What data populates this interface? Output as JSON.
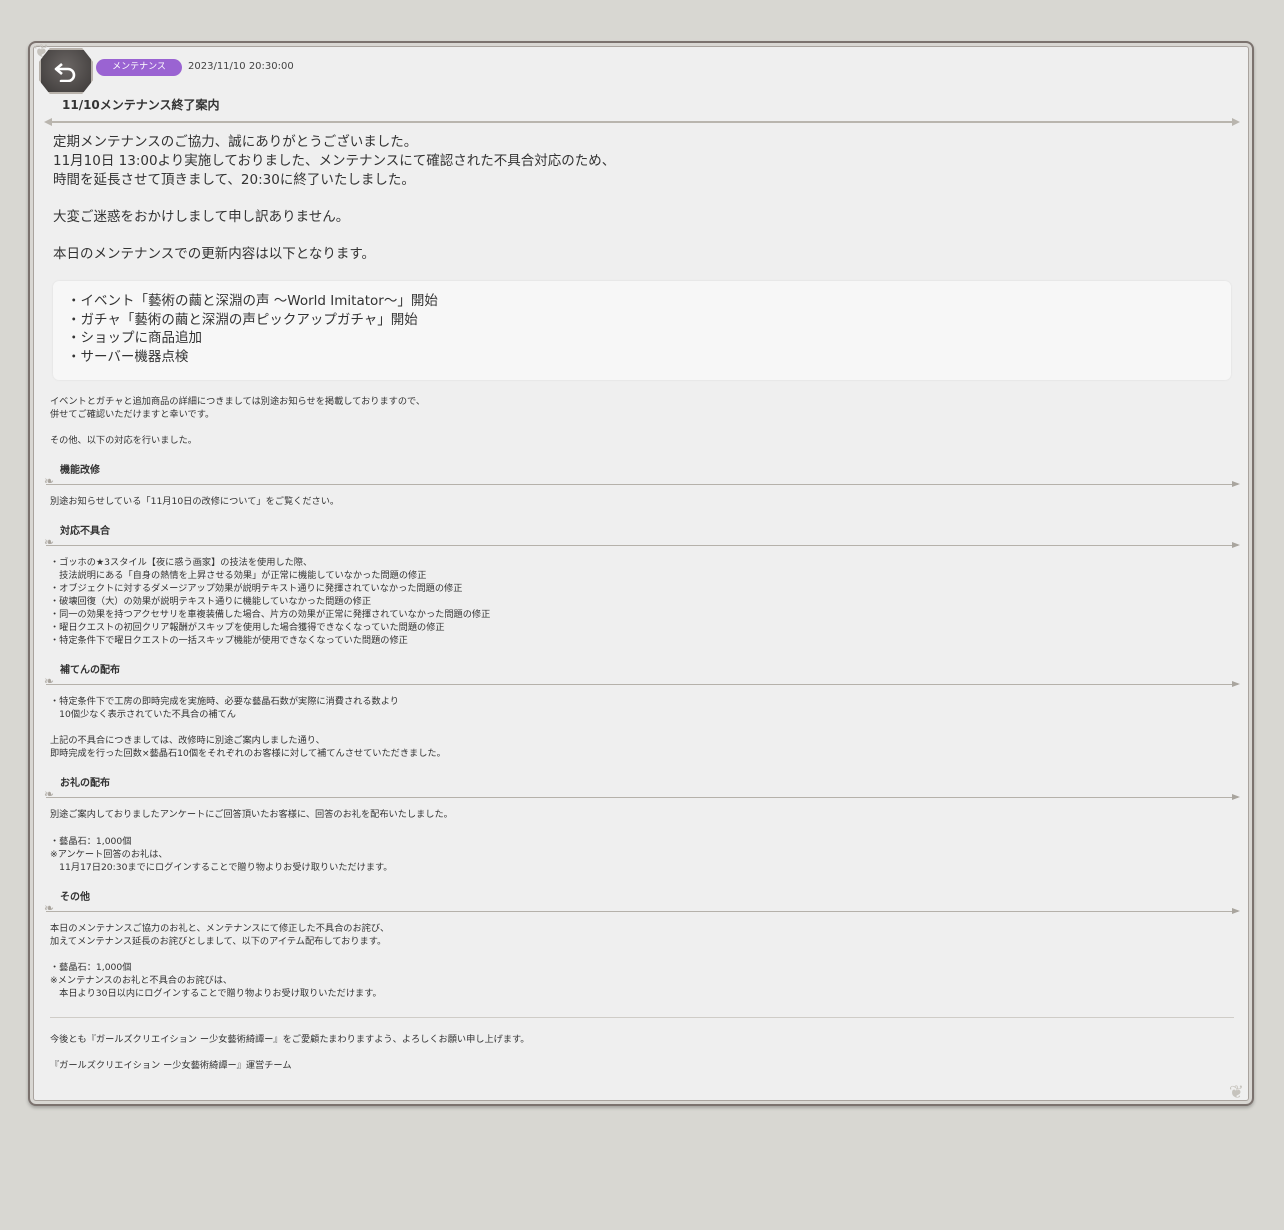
{
  "header": {
    "tag": "メンテナンス",
    "date": "2023/11/10 20:30:00",
    "title": "11/10メンテナンス終了案内",
    "back_icon": "back-arrow-icon"
  },
  "intro": [
    "定期メンテナンスのご協力、誠にありがとうございました。",
    "11月10日 13:00より実施しておりました、メンテナンスにて確認された不具合対応のため、",
    "時間を延長させて頂きまして、20:30に終了いたしました。",
    "大変ご迷惑をおかけしまして申し訳ありません。",
    "本日のメンテナンスでの更新内容は以下となります。"
  ],
  "updates": [
    "・イベント「藝術の繭と深淵の声 〜World Imitator〜」開始",
    "・ガチャ「藝術の繭と深淵の声ピックアップガチャ」開始",
    "・ショップに商品追加",
    "・サーバー機器点検"
  ],
  "notes": [
    "イベントとガチャと追加商品の詳細につきましては別途お知らせを掲載しておりますので、",
    "併せてご確認いただけますと幸いです。",
    "その他、以下の対応を行いました。"
  ],
  "sections": {
    "improve": {
      "title": "機能改修",
      "lines": [
        "別途お知らせしている「11月10日の改修について」をご覧ください。"
      ]
    },
    "bugs": {
      "title": "対応不具合",
      "lines": [
        "・ゴッホの★3スタイル【夜に惑う画家】の技法を使用した際、",
        "　技法説明にある「自身の熱情を上昇させる効果」が正常に機能していなかった問題の修正",
        "・オブジェクトに対するダメージアップ効果が説明テキスト通りに発揮されていなかった問題の修正",
        "・破壊回復（大）の効果が説明テキスト通りに機能していなかった問題の修正",
        "・同一の効果を持つアクセサリを車複装備した場合、片方の効果が正常に発揮されていなかった問題の修正",
        "・曜日クエストの初回クリア報酬がスキップを使用した場合獲得できなくなっていた問題の修正",
        "・特定条件下で曜日クエストの一括スキップ機能が使用できなくなっていた問題の修正"
      ]
    },
    "compensation": {
      "title": "補てんの配布",
      "lines": [
        "・特定条件下で工房の即時完成を実施時、必要な藝晶石数が実際に消費される数より",
        "　10個少なく表示されていた不具合の補てん",
        "上記の不具合につきましては、改修時に別途ご案内しました通り、",
        "即時完成を行った回数×藝晶石10個をそれぞれのお客様に対して補てんさせていただきました。"
      ]
    },
    "thanks": {
      "title": "お礼の配布",
      "lines": [
        "別途ご案内しておりましたアンケートにご回答頂いたお客様に、回答のお礼を配布いたしました。",
        "・藝晶石：1,000個",
        "※アンケート回答のお礼は、",
        "　11月17日20:30までにログインすることで贈り物よりお受け取りいただけます。"
      ]
    },
    "other": {
      "title": "その他",
      "lines": [
        "本日のメンテナンスご協力のお礼と、メンテナンスにて修正した不具合のお詫び、",
        "加えてメンテナンス延長のお詫びとしまして、以下のアイテム配布しております。",
        "・藝晶石：1,000個",
        "※メンテナンスのお礼と不具合のお詫びは、",
        "　本日より30日以内にログインすることで贈り物よりお受け取りいただけます。"
      ]
    }
  },
  "footer": [
    "今後とも『ガールズクリエイション ー少女藝術綺譚ー』をご愛顧たまわりますよう、よろしくお願い申し上げます。",
    "『ガールズクリエイション ー少女藝術綺譚ー』運営チーム"
  ]
}
